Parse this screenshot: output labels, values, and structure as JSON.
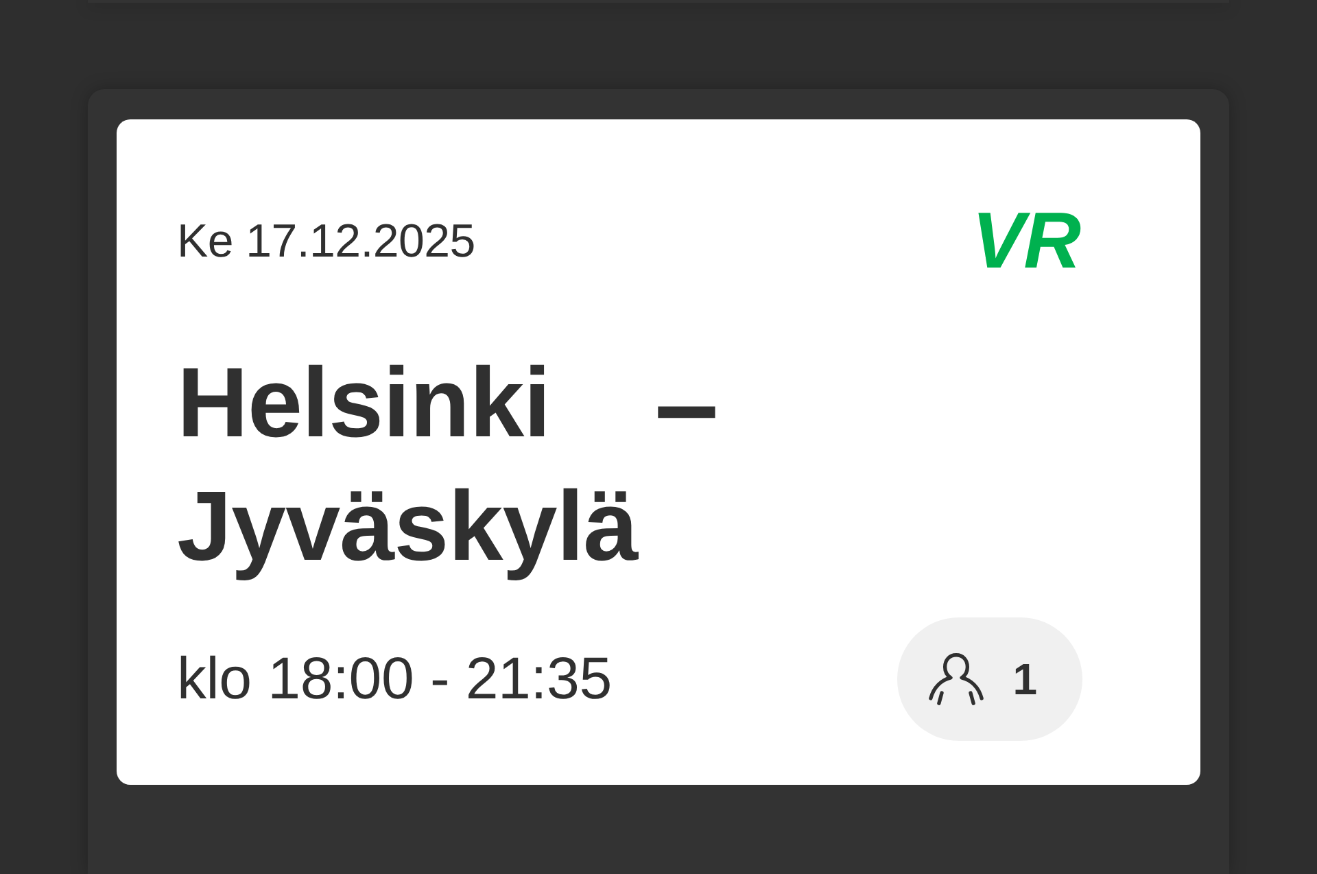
{
  "ticket": {
    "date": "Ke 17.12.2025",
    "logo": "VR",
    "route": {
      "origin": "Helsinki",
      "separator": "–",
      "destination": "Jyväskylä"
    },
    "time": "klo 18:00 - 21:35",
    "passengers": {
      "count": "1"
    }
  }
}
